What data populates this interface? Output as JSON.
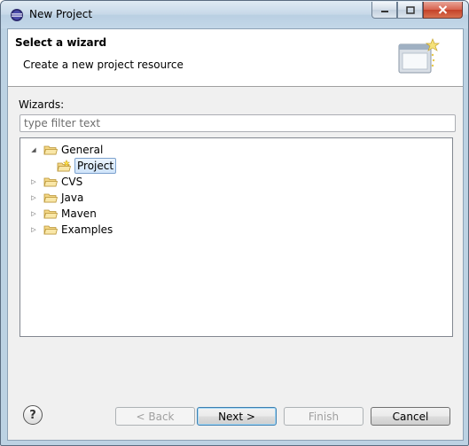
{
  "window": {
    "title": "New Project"
  },
  "caption": {
    "minimize": "minimize-icon",
    "maximize": "maximize-icon",
    "close": "close-icon"
  },
  "header": {
    "title": "Select a wizard",
    "description": "Create a new project resource",
    "image": "wizard-banner-icon"
  },
  "wizards": {
    "label": "Wizards:",
    "filter_placeholder": "type filter text",
    "filter_value": ""
  },
  "tree": {
    "items": [
      {
        "label": "General",
        "expanded": true,
        "level": 0
      },
      {
        "label": "Project",
        "expanded": false,
        "level": 1,
        "selected": true
      },
      {
        "label": "CVS",
        "expanded": false,
        "level": 0
      },
      {
        "label": "Java",
        "expanded": false,
        "level": 0
      },
      {
        "label": "Maven",
        "expanded": false,
        "level": 0
      },
      {
        "label": "Examples",
        "expanded": false,
        "level": 0
      }
    ]
  },
  "buttons": {
    "help": "?",
    "back": "< Back",
    "next": "Next >",
    "finish": "Finish",
    "cancel": "Cancel"
  },
  "colors": {
    "accent": "#3c7fb1",
    "selection": "#cfe4fa",
    "folder": "#e8c15a"
  }
}
